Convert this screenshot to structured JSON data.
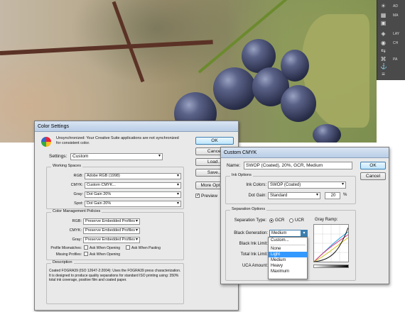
{
  "side_panel": {
    "items": [
      {
        "icon": "sun-icon",
        "label": "AD"
      },
      {
        "icon": "grid-icon",
        "label": "MA"
      },
      {
        "icon": "image-icon",
        "label": ""
      },
      {
        "icon": "layers-icon",
        "label": "LAY"
      },
      {
        "icon": "channels-icon",
        "label": "CH"
      },
      {
        "icon": "adjust-icon",
        "label": ""
      },
      {
        "icon": "paths-icon",
        "label": "PA"
      },
      {
        "icon": "anchor-icon",
        "label": ""
      },
      {
        "icon": "bars-icon",
        "label": ""
      }
    ]
  },
  "color_settings": {
    "title": "Color Settings",
    "sync_text": "Unsynchronized: Your Creative Suite applications are not synchronized for consistent color.",
    "settings_label": "Settings:",
    "settings_value": "Custom",
    "working_spaces": "Working Spaces",
    "rgb_label": "RGB:",
    "rgb_value": "Adobe RGB (1998)",
    "cmyk_label": "CMYK:",
    "cmyk_value": "Custom CMYK...",
    "gray_label": "Gray:",
    "gray_value": "Dot Gain 20%",
    "spot_label": "Spot:",
    "spot_value": "Dot Gain 20%",
    "policies": "Color Management Policies",
    "p_rgb_label": "RGB:",
    "p_rgb_value": "Preserve Embedded Profiles",
    "p_cmyk_label": "CMYK:",
    "p_cmyk_value": "Preserve Embedded Profiles",
    "p_gray_label": "Gray:",
    "p_gray_value": "Preserve Embedded Profiles",
    "mismatch_label": "Profile Mismatches:",
    "ask_opening": "Ask When Opening",
    "ask_pasting": "Ask When Pasting",
    "missing_label": "Missing Profiles:",
    "ask_opening2": "Ask When Opening",
    "description": "Description",
    "desc_text": "Coated FOGRA39 (ISO 12647-2:2004): Uses the FOGRA39 press characterization. It is designed to produce quality separations for standard ISO printing using: 350% total ink coverage, positive film and coated paper.",
    "ok": "OK",
    "cancel": "Cancel",
    "load": "Load...",
    "save": "Save...",
    "more": "More Options",
    "preview": "Preview"
  },
  "custom_cmyk": {
    "title": "Custom CMYK",
    "name_label": "Name:",
    "name_value": "SWOP (Coated), 20%, GCR, Medium",
    "ok": "OK",
    "cancel": "Cancel",
    "ink_options": "Ink Options",
    "ink_colors_label": "Ink Colors:",
    "ink_colors_value": "SWOP (Coated)",
    "dot_gain_label": "Dot Gain:",
    "dot_gain_value": "Standard",
    "dot_gain_num": "20",
    "percent": "%",
    "sep_options": "Separation Options",
    "sep_type_label": "Separation Type:",
    "gcr": "GCR",
    "ucr": "UCR",
    "gray_ramp": "Gray Ramp:",
    "black_gen_label": "Black Generation:",
    "black_gen_value": "Medium",
    "black_ink_label": "Black Ink Limit:",
    "total_ink_label": "Total Ink Limit:",
    "uca_label": "UCA Amount:",
    "menu": [
      "Custom...",
      "None",
      "Light",
      "Medium",
      "Heavy",
      "Maximum"
    ],
    "menu_selected": "Light"
  }
}
